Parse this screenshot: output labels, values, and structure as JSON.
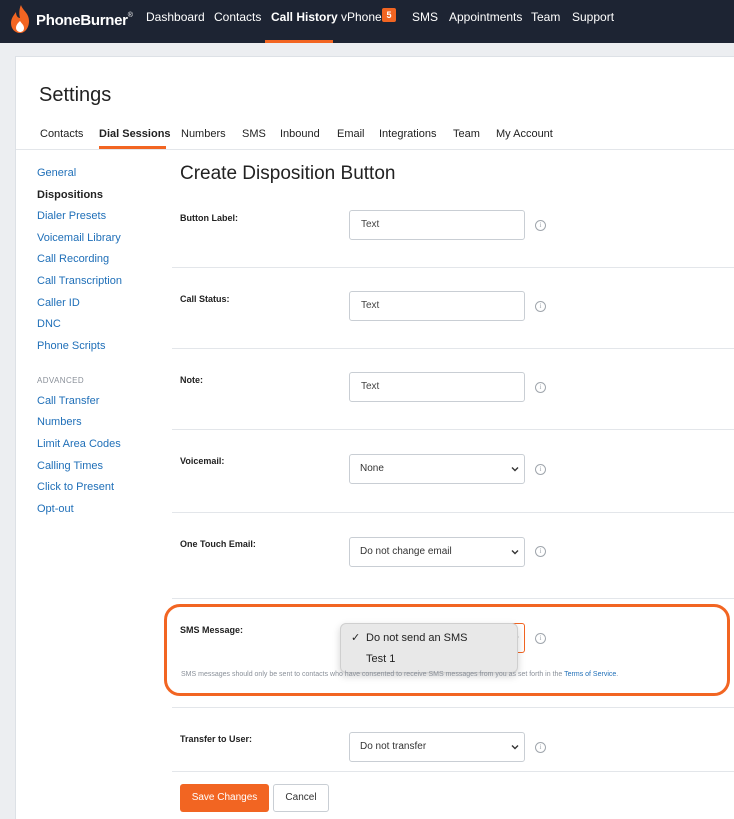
{
  "brand": {
    "name": "PhoneBurner",
    "trademark": "®",
    "accent": "#f26522",
    "nav_bg": "#1d2433",
    "link": "#1f6fb8"
  },
  "topnav": {
    "items": [
      {
        "label": "Dashboard"
      },
      {
        "label": "Contacts"
      },
      {
        "label": "Call History"
      },
      {
        "label": "vPhone"
      },
      {
        "label": "SMS"
      },
      {
        "label": "Appointments"
      },
      {
        "label": "Team"
      },
      {
        "label": "Support"
      }
    ],
    "vphone_badge": "5"
  },
  "page": {
    "title": "Settings"
  },
  "subtabs": [
    "Contacts",
    "Dial Sessions",
    "Numbers",
    "SMS",
    "Inbound",
    "Email",
    "Integrations",
    "Team",
    "My Account"
  ],
  "sidebar": {
    "items": [
      "General",
      "Dispositions",
      "Dialer Presets",
      "Voicemail Library",
      "Call Recording",
      "Call Transcription",
      "Caller ID",
      "DNC",
      "Phone Scripts"
    ],
    "advanced_heading": "ADVANCED",
    "advanced_items": [
      "Call Transfer",
      "Numbers",
      "Limit Area Codes",
      "Calling Times",
      "Click to Present",
      "Opt-out"
    ]
  },
  "form": {
    "title": "Create Disposition Button",
    "fields": {
      "button_label": {
        "label": "Button Label:",
        "value": "Text"
      },
      "call_status": {
        "label": "Call Status:",
        "value": "Text"
      },
      "note": {
        "label": "Note:",
        "value": "Text"
      },
      "voicemail": {
        "label": "Voicemail:",
        "value": "None"
      },
      "one_touch_email": {
        "label": "One Touch Email:",
        "value": "Do not change email"
      },
      "sms_message": {
        "label": "SMS Message:",
        "options": [
          "Do not send an SMS",
          "Test 1"
        ],
        "selected_check": "✓",
        "help_text": "SMS messages should only be sent to contacts who have consented to receive SMS messages from you as set forth in the ",
        "help_link": "Terms of Service",
        "help_end": "."
      },
      "transfer_to_user": {
        "label": "Transfer to User:",
        "value": "Do not transfer"
      }
    },
    "info_glyph": "i",
    "save_label": "Save Changes",
    "cancel_label": "Cancel"
  }
}
